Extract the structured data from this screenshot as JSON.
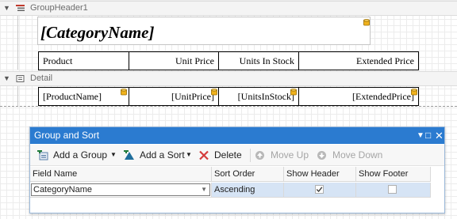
{
  "designer": {
    "group_header_band": "GroupHeader1",
    "detail_band": "Detail",
    "category_field": "[CategoryName]",
    "header_columns": [
      "Product",
      "Unit Price",
      "Units In Stock",
      "Extended Price"
    ],
    "detail_fields": [
      "[ProductName]",
      "[UnitPrice]",
      "[UnitsInStock]",
      "[ExtendedPrice]"
    ]
  },
  "panel": {
    "title": "Group and Sort",
    "toolbar": {
      "add_group": "Add a Group",
      "add_sort": "Add a Sort",
      "delete": "Delete",
      "move_up": "Move Up",
      "move_down": "Move Down"
    },
    "columns": [
      "Field Name",
      "Sort Order",
      "Show Header",
      "Show Footer"
    ],
    "rows": [
      {
        "field": "CategoryName",
        "sort_order": "Ascending",
        "show_header": true,
        "show_footer": false
      }
    ]
  },
  "colors": {
    "title_bar": "#2b7bd0",
    "selection": "#d6e4f5",
    "delete_icon": "#d43b3b",
    "add_icon": "#1f7a3a"
  },
  "icons": [
    "collapse-triangle-icon",
    "group-header-band-icon",
    "detail-band-icon",
    "database-field-icon",
    "add-group-icon",
    "add-sort-icon",
    "delete-icon",
    "move-up-icon",
    "move-down-icon",
    "dropdown-icon",
    "maximize-icon",
    "close-icon",
    "checkmark-icon"
  ]
}
